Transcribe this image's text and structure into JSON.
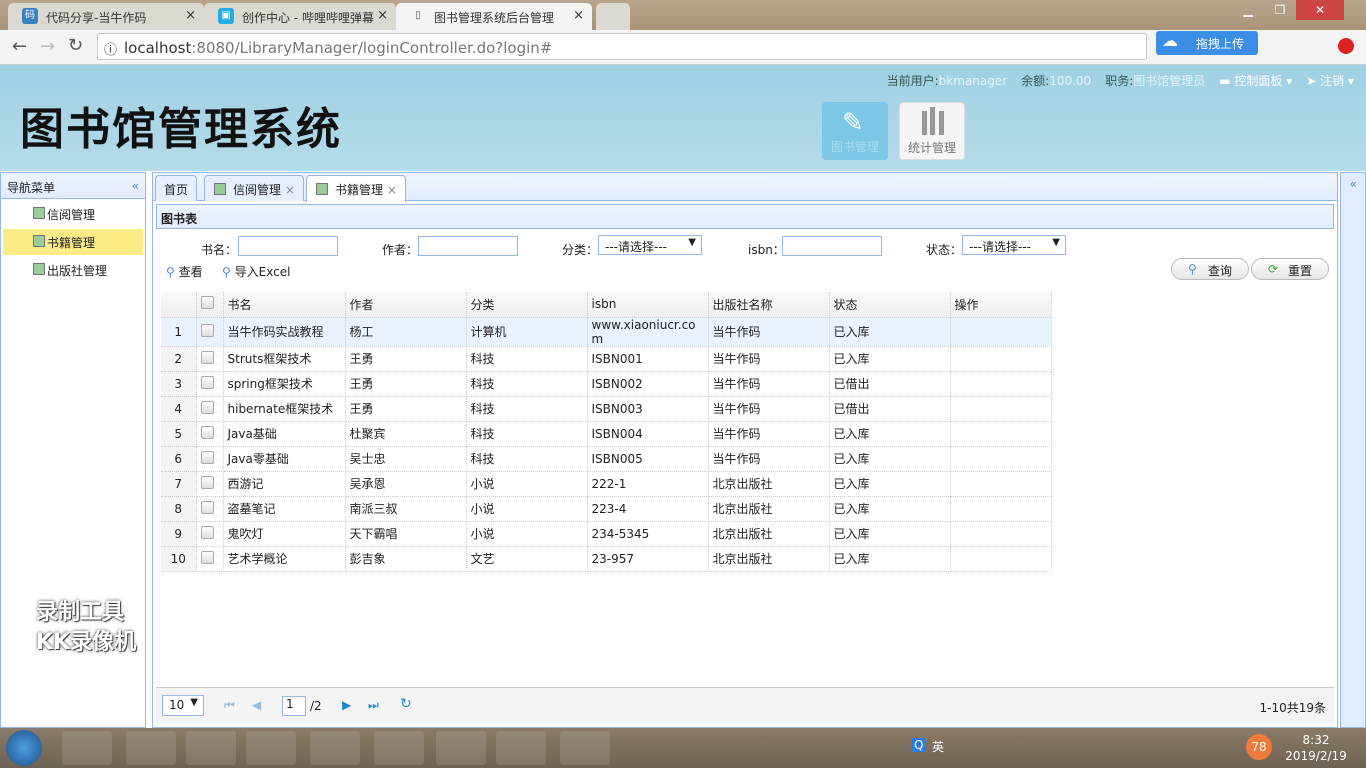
{
  "browser": {
    "tabs": [
      {
        "title": "代码分享-当牛作码",
        "icon": "码"
      },
      {
        "title": "创作中心 - 哔哩哔哩弹幕",
        "icon": "b"
      },
      {
        "title": "图书管理系统后台管理",
        "icon": "doc"
      }
    ],
    "url_host": "localhost",
    "url_port": ":8080",
    "url_path": "/LibraryManager/loginController.do?login#",
    "upload_label": "拖拽上传"
  },
  "header": {
    "logo": "图书馆管理系统",
    "user_label": "当前用户:",
    "user": "bkmanager",
    "balance_label": "余额:",
    "balance": "100.00",
    "role_label": "职务:",
    "role": "图书馆管理员",
    "control_panel": "控制面板",
    "logout": "注销",
    "buttons": [
      {
        "label": "图书管理",
        "icon": "edit-icon"
      },
      {
        "label": "统计管理",
        "icon": "bar-chart-icon"
      }
    ]
  },
  "sidebar": {
    "title": "导航菜单",
    "items": [
      {
        "label": "信阅管理"
      },
      {
        "label": "书籍管理",
        "selected": true
      },
      {
        "label": "出版社管理"
      }
    ]
  },
  "main": {
    "tabs": [
      "首页",
      "信阅管理",
      "书籍管理"
    ],
    "panel_title": "图书表",
    "filters": {
      "name_label": "书名：",
      "author_label": "作者：",
      "category_label": "分类：",
      "category_value": "---请选择---",
      "isbn_label": "isbn：",
      "status_label": "状态：",
      "status_value": "---请选择---"
    },
    "toolbar": {
      "view": "查看",
      "import": "导入Excel",
      "query": "查询",
      "reset": "重置"
    },
    "columns": [
      "书名",
      "作者",
      "分类",
      "isbn",
      "出版社名称",
      "状态",
      "操作"
    ],
    "rows": [
      [
        "当牛作码实战教程",
        "杨工",
        "计算机",
        "www.xiaoniucr.com",
        "当牛作码",
        "已入库"
      ],
      [
        "Struts框架技术",
        "王勇",
        "科技",
        "ISBN001",
        "当牛作码",
        "已入库"
      ],
      [
        "spring框架技术",
        "王勇",
        "科技",
        "ISBN002",
        "当牛作码",
        "已借出"
      ],
      [
        "hibernate框架技术",
        "王勇",
        "科技",
        "ISBN003",
        "当牛作码",
        "已借出"
      ],
      [
        "Java基础",
        "杜聚宾",
        "科技",
        "ISBN004",
        "当牛作码",
        "已入库"
      ],
      [
        "Java零基础",
        "吴士忠",
        "科技",
        "ISBN005",
        "当牛作码",
        "已入库"
      ],
      [
        "西游记",
        "吴承恩",
        "小说",
        "222-1",
        "北京出版社",
        "已入库"
      ],
      [
        "盗墓笔记",
        "南派三叔",
        "小说",
        "223-4",
        "北京出版社",
        "已入库"
      ],
      [
        "鬼吹灯",
        "天下霸唱",
        "小说",
        "234-5345",
        "北京出版社",
        "已入库"
      ],
      [
        "艺术学概论",
        "彭吉象",
        "文艺",
        "23-957",
        "北京出版社",
        "已入库"
      ]
    ],
    "pager": {
      "page_size": "10",
      "page": "1",
      "total_pages": "/2",
      "summary": "1-10共19条"
    }
  },
  "watermark": {
    "line1": "录制工具",
    "line2": "KK录像机"
  },
  "taskbar": {
    "time": "8:32",
    "date": "2019/2/19",
    "lang": "英",
    "badge": "78"
  }
}
